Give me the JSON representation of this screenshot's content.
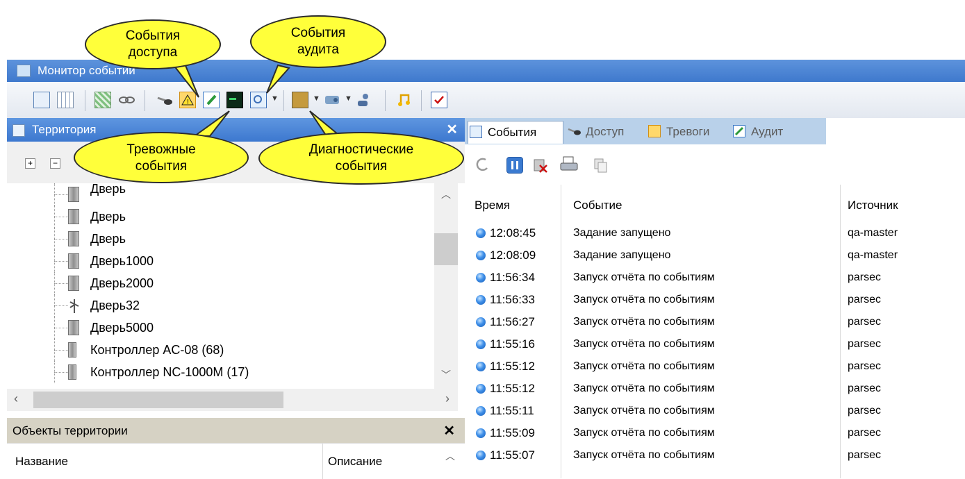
{
  "window": {
    "title": "Монитор событий"
  },
  "toolbar": {
    "icons": [
      "tree-view-icon",
      "grid-view-icon",
      "map-view-icon",
      "eye-icon",
      "access-key-icon",
      "alarm-icon",
      "audit-icon",
      "diagnostic-icon",
      "search-icon",
      "person-card-icon",
      "device-icon",
      "users-icon",
      "music-note-icon",
      "checklist-icon"
    ]
  },
  "callouts": {
    "access": [
      "События",
      "доступа"
    ],
    "audit": [
      "События",
      "аудита"
    ],
    "alarms": [
      "Тревожные",
      "события"
    ],
    "diagnostic": [
      "Диагностические",
      "события"
    ]
  },
  "territory_panel": {
    "title": "Территория",
    "tree": [
      {
        "label": "Дверь",
        "icon": "door-icon"
      },
      {
        "label": "Дверь",
        "icon": "door-icon"
      },
      {
        "label": "Дверь",
        "icon": "door-icon"
      },
      {
        "label": "Дверь1000",
        "icon": "door-icon"
      },
      {
        "label": "Дверь2000",
        "icon": "door-icon"
      },
      {
        "label": "Дверь32",
        "icon": "turnstile-icon"
      },
      {
        "label": "Дверь5000",
        "icon": "door-icon"
      },
      {
        "label": "Контроллер AC-08 (68)",
        "icon": "controller-icon"
      },
      {
        "label": "Контроллер NC-1000M (17)",
        "icon": "controller-icon"
      }
    ]
  },
  "objects_panel": {
    "title": "Объекты территории",
    "columns": [
      "Название",
      "Описание"
    ]
  },
  "tabs": [
    {
      "label": "События",
      "icon": "search-icon",
      "active": true
    },
    {
      "label": "Доступ",
      "icon": "access-key-icon",
      "active": false
    },
    {
      "label": "Тревоги",
      "icon": "alarm-icon",
      "active": false
    },
    {
      "label": "Аудит",
      "icon": "audit-icon",
      "active": false
    }
  ],
  "events": {
    "columns": [
      "Время",
      "Событие",
      "Источник"
    ],
    "rows": [
      {
        "time": "12:08:45",
        "event": "Задание запущено",
        "source": "qa-master"
      },
      {
        "time": "12:08:09",
        "event": "Задание запущено",
        "source": "qa-master"
      },
      {
        "time": "11:56:34",
        "event": "Запуск отчёта по событиям",
        "source": "parsec"
      },
      {
        "time": "11:56:33",
        "event": "Запуск отчёта по событиям",
        "source": "parsec"
      },
      {
        "time": "11:56:27",
        "event": "Запуск отчёта по событиям",
        "source": "parsec"
      },
      {
        "time": "11:55:16",
        "event": "Запуск отчёта по событиям",
        "source": "parsec"
      },
      {
        "time": "11:55:12",
        "event": "Запуск отчёта по событиям",
        "source": "parsec"
      },
      {
        "time": "11:55:12",
        "event": "Запуск отчёта по событиям",
        "source": "parsec"
      },
      {
        "time": "11:55:11",
        "event": "Запуск отчёта по событиям",
        "source": "parsec"
      },
      {
        "time": "11:55:09",
        "event": "Запуск отчёта по событиям",
        "source": "parsec"
      },
      {
        "time": "11:55:07",
        "event": "Запуск отчёта по событиям",
        "source": "parsec"
      }
    ]
  },
  "colors": {
    "title_bar": "#4a84d4",
    "callout": "#ffff3a",
    "tab_strip": "#b9d1ea",
    "event_dot": "#3d8ee8"
  }
}
